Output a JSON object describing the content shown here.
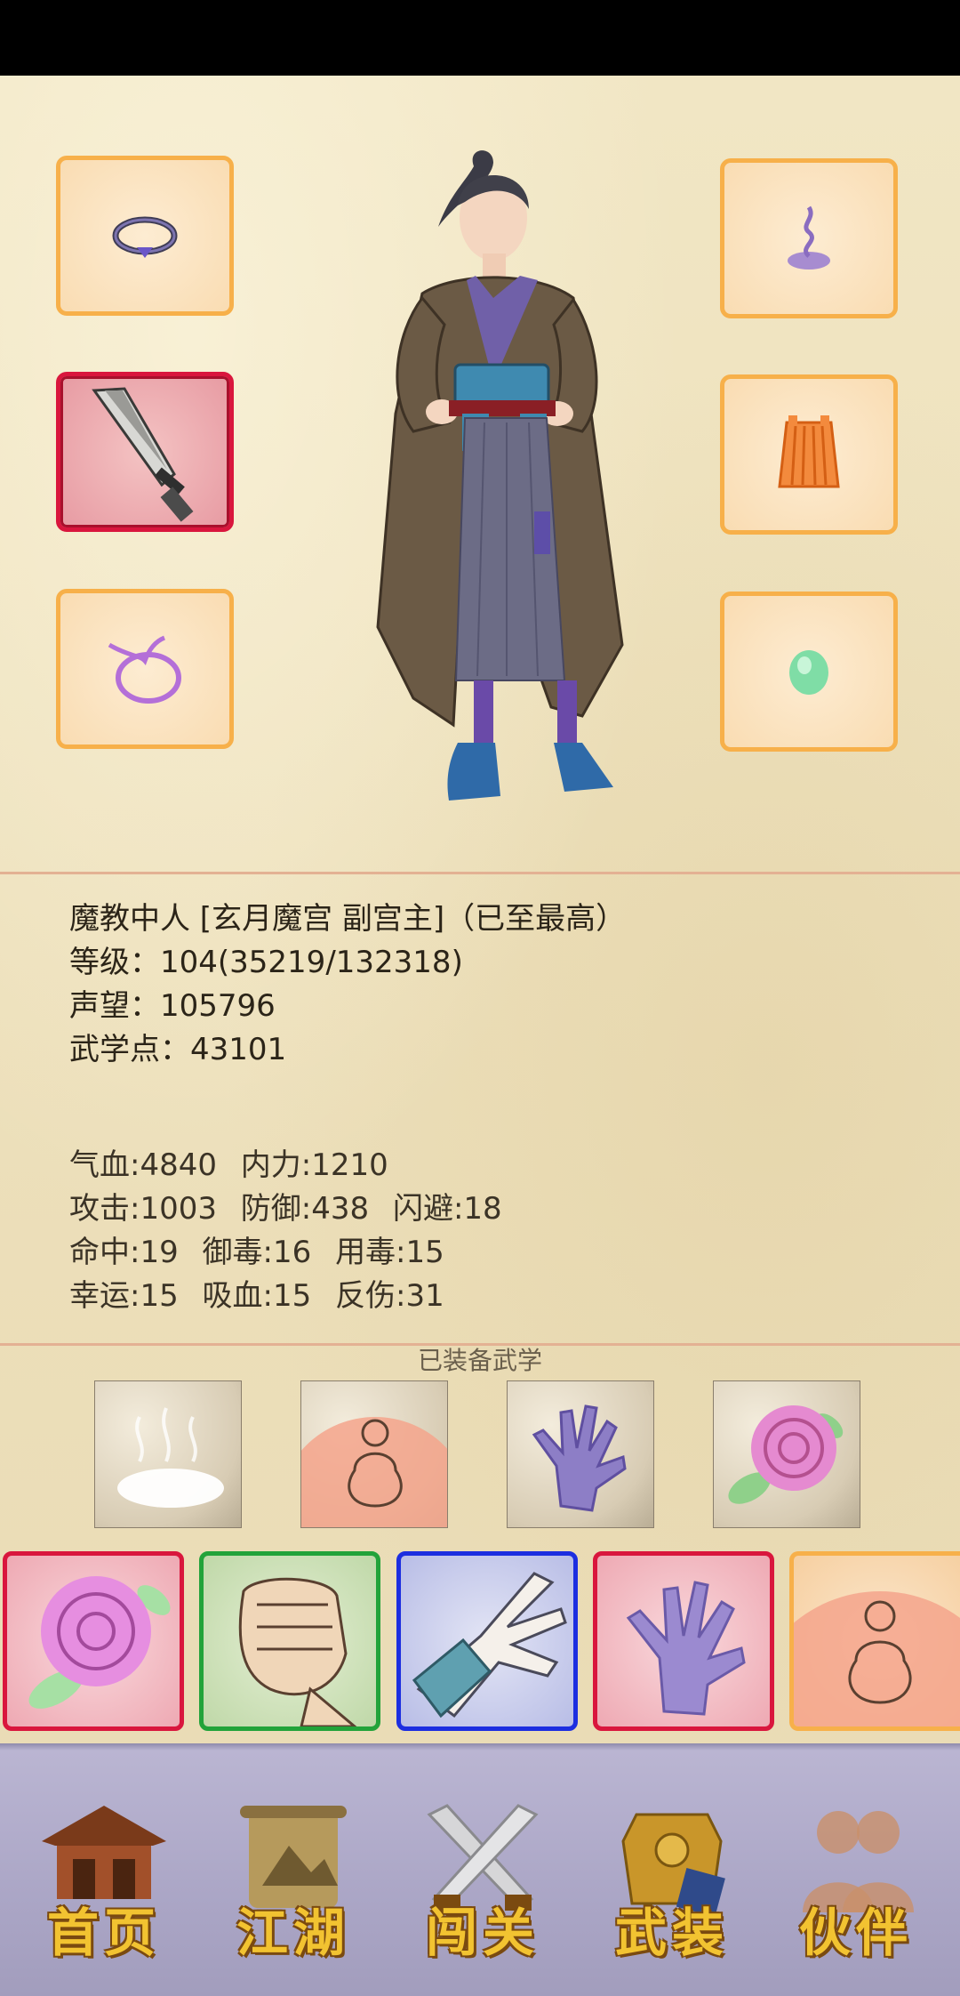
{
  "character": {
    "title_line": "魔教中人 [玄月魔宫 副宫主]（已至最高）",
    "level_line": "等级：104(35219/132318)",
    "prestige_line": "声望：105796",
    "martial_points_line": "武学点：43101"
  },
  "stats": {
    "row1": [
      "气血:4840",
      "内力:1210"
    ],
    "row2": [
      "攻击:1003",
      "防御:438",
      "闪避:18"
    ],
    "row3": [
      "命中:19",
      "御毒:16",
      "用毒:15"
    ],
    "row4": [
      "幸运:15",
      "吸血:15",
      "反伤:31"
    ]
  },
  "equipped_section_label": "已装备武学",
  "equipment_slots": {
    "left": [
      "ring-icon",
      "blade-icon",
      "cord-icon"
    ],
    "right": [
      "incense-icon",
      "armor-skirt-icon",
      "jade-icon"
    ]
  },
  "equipped_skills": [
    "mist-icon",
    "meditation-icon",
    "purple-palm-icon",
    "rose-icon"
  ],
  "skill_cards": [
    {
      "icon": "rose-icon",
      "border": "#d9163d"
    },
    {
      "icon": "fist-icon",
      "border": "#22a33a"
    },
    {
      "icon": "claw-icon",
      "border": "#1c2ee0"
    },
    {
      "icon": "purple-palm-icon",
      "border": "#d9163d"
    },
    {
      "icon": "meditation-icon",
      "border": "#f7b04a"
    }
  ],
  "nav": [
    {
      "label": "首页",
      "icon": "house-icon"
    },
    {
      "label": "江湖",
      "icon": "scroll-icon"
    },
    {
      "label": "闯关",
      "icon": "crossed-swords-icon"
    },
    {
      "label": "武装",
      "icon": "armor-icon"
    },
    {
      "label": "伙伴",
      "icon": "partners-icon"
    }
  ]
}
